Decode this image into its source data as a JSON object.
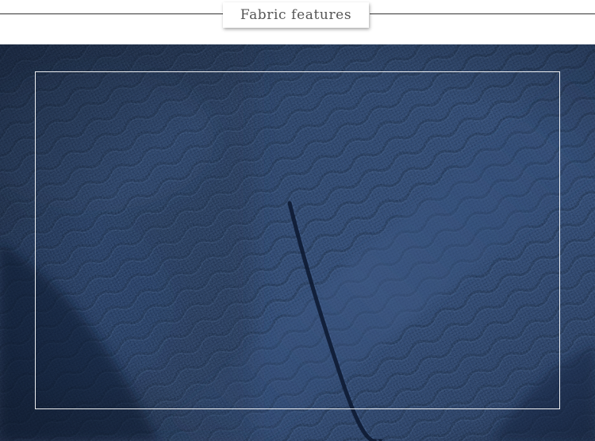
{
  "header": {
    "title": "Fabric features"
  },
  "colors": {
    "fabric_base": "#1f3558",
    "fabric_dark": "#0f1d36",
    "fabric_light": "#3a5581",
    "frame": "#ffffff",
    "title_text": "#555555",
    "rule": "#333333"
  }
}
